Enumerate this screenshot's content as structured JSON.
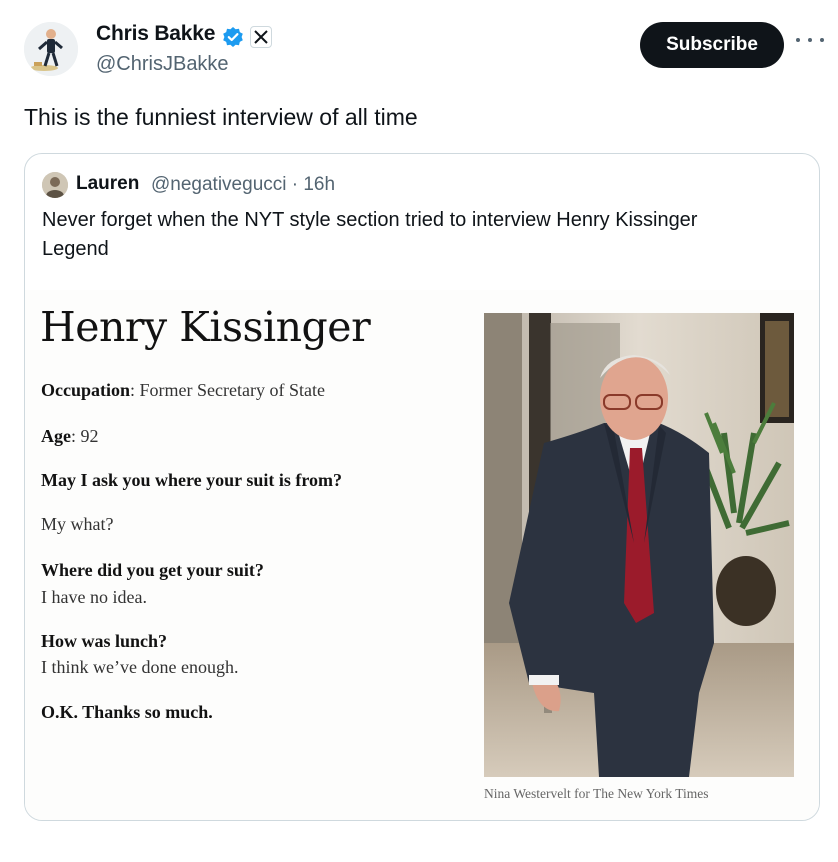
{
  "author": {
    "name": "Chris Bakke",
    "handle": "@ChrisJBakke"
  },
  "actions": {
    "subscribe_label": "Subscribe"
  },
  "tweet": {
    "text": "This is the funniest interview of all time"
  },
  "quoted": {
    "name": "Lauren",
    "meta": "@negativegucci · 16h",
    "text_line1": "Never forget when the NYT style section tried to interview Henry Kissinger",
    "text_line2": "Legend"
  },
  "article": {
    "title": "Henry Kissinger",
    "occupation_label": "Occupation",
    "occupation_value": ": Former Secretary of State",
    "age_label": "Age",
    "age_value": ": 92",
    "q1": "May I ask you where your suit is from?",
    "a1": "My what?",
    "q2": "Where did you get your suit?",
    "a2": "I have no idea.",
    "q3": "How was lunch?",
    "a3": "I think we’ve done enough.",
    "q4": "O.K. Thanks so much.",
    "photo_credit": "Nina Westervelt for The New York Times"
  },
  "colors": {
    "verified": "#1d9bf0",
    "subscribe_bg": "#0f1419",
    "secondary_text": "#536471",
    "tie": "#9b1b2b"
  },
  "icons": {
    "verified": "verified-badge-icon",
    "x_logo": "x-logo-icon",
    "more": "more-dots-icon"
  }
}
